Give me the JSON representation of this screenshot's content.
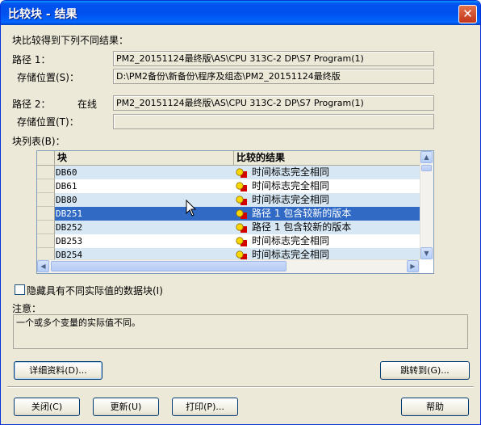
{
  "window": {
    "title": "比较块 - 结果",
    "close_symbol": "✕"
  },
  "header_text": "块比较得到下列不同结果：",
  "path1": {
    "label": "路径 1：",
    "value": "PM2_20151124最终版\\AS\\CPU 313C-2 DP\\S7 Program(1)",
    "storage_label": "存储位置(S)：",
    "storage_value": "D:\\PM2备份\\新备份\\程序及组态\\PM2_20151124最终版"
  },
  "path2": {
    "label": "路径 2：",
    "status": "在线",
    "value": "PM2_20151124最终版\\AS\\CPU 313C-2 DP\\S7 Program(1)",
    "storage_label": "存储位置(T)：",
    "storage_value": ""
  },
  "block_list": {
    "label": "块列表(B)：",
    "columns": [
      "块",
      "比较的结果"
    ],
    "rows": [
      {
        "name": "DB60",
        "result": "时间标志完全相同"
      },
      {
        "name": "DB61",
        "result": "时间标志完全相同"
      },
      {
        "name": "DB80",
        "result": "时间标志完全相同"
      },
      {
        "name": "DB251",
        "result": "路径 1  包含较新的版本"
      },
      {
        "name": "DB252",
        "result": "路径 1  包含较新的版本"
      },
      {
        "name": "DB253",
        "result": "时间标志完全相同"
      },
      {
        "name": "DB254",
        "result": "时间标志完全相同"
      }
    ],
    "selected_index": 3,
    "icon": "compare-status-icon"
  },
  "hide_checkbox": {
    "label": "隐藏具有不同实际值的数据块(I)",
    "checked": false
  },
  "note": {
    "label": "注意：",
    "text": "一个或多个变量的实际值不同。"
  },
  "buttons": {
    "details": "详细资料(D)...",
    "goto": "跳转到(G)...",
    "close": "关闭(C)",
    "update": "更新(U)",
    "print": "打印(P)...",
    "help": "帮助"
  },
  "colors": {
    "title_bar": "#0053ee",
    "selection": "#316ac5",
    "alt_row": "#d7e8f4",
    "dialog_bg": "#ece9d8"
  }
}
